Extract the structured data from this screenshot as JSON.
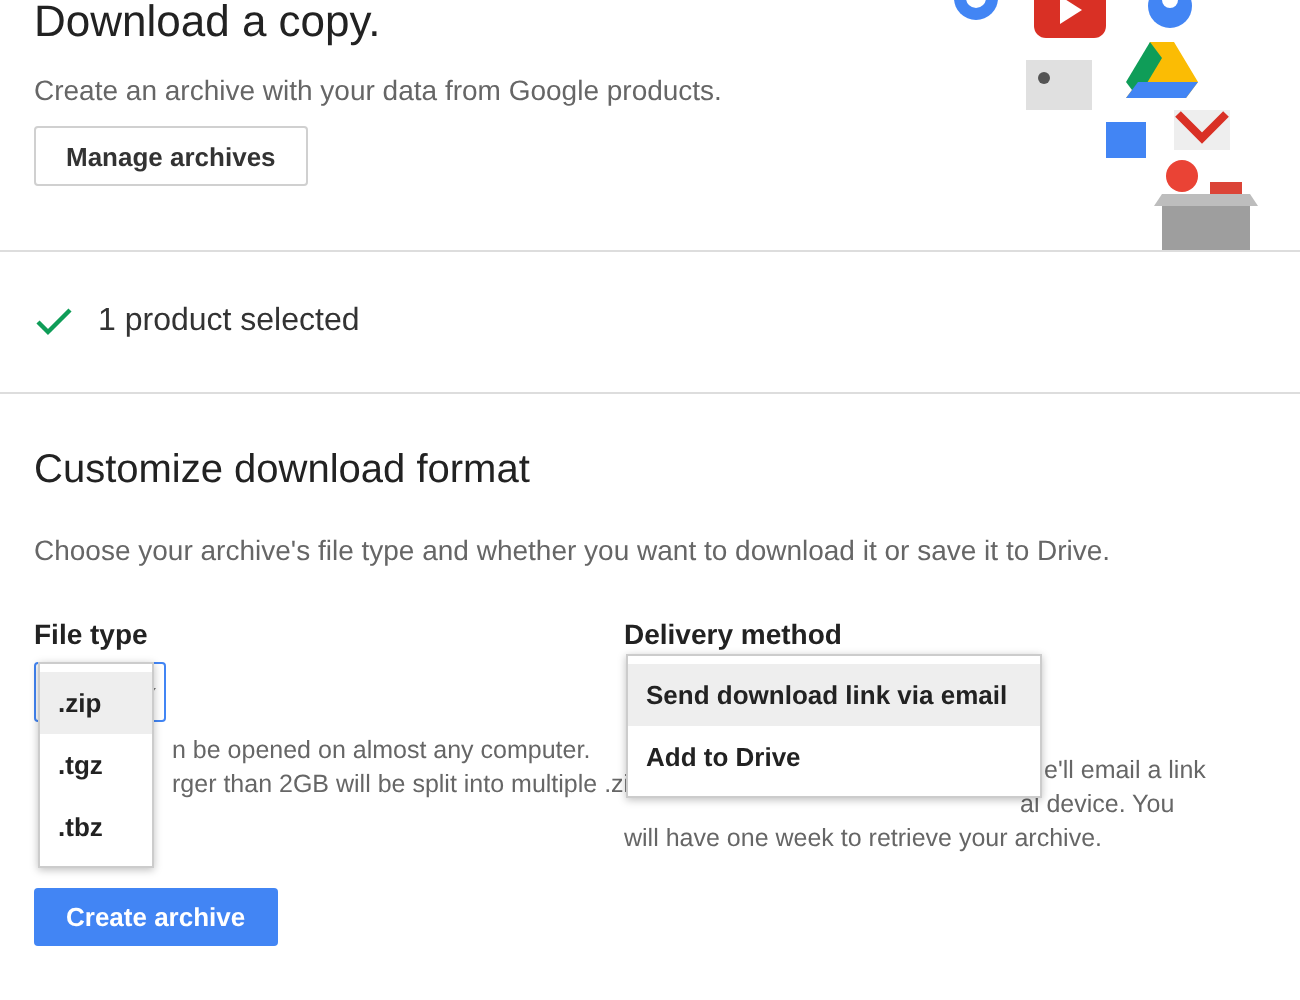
{
  "header": {
    "title": "Download a copy.",
    "subtitle": "Create an archive with your data from Google products.",
    "manage_button": "Manage archives"
  },
  "selection": {
    "text": "1 product selected"
  },
  "customize": {
    "title": "Customize download format",
    "description": "Choose your archive's file type and whether you want to download it or save it to Drive."
  },
  "file_type": {
    "label": "File type",
    "options": [
      {
        "label": ".zip",
        "selected": true
      },
      {
        "label": ".tgz",
        "selected": false
      },
      {
        "label": ".tbz",
        "selected": false
      }
    ],
    "help_lines": [
      "n be opened on almost any computer.",
      "rger than 2GB will be split into multiple .zi"
    ]
  },
  "delivery": {
    "label": "Delivery method",
    "options": [
      {
        "label": "Send download link via email",
        "selected": true
      },
      {
        "label": "Add to Drive",
        "selected": false
      }
    ],
    "help_lines": [
      "e'll email a link",
      "al device. You",
      "will have one week to retrieve your archive."
    ]
  },
  "create_button": "Create archive"
}
